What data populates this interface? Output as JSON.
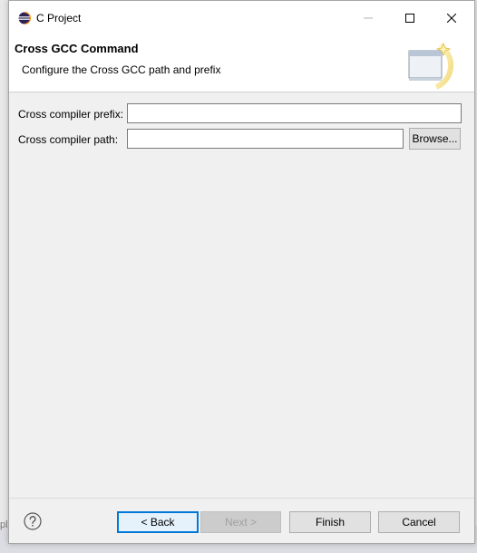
{
  "window": {
    "title": "C Project",
    "app_icon": "eclipse-icon",
    "controls": {
      "minimize_icon": "minimize-icon",
      "maximize_icon": "maximize-icon",
      "close_icon": "close-icon"
    }
  },
  "banner": {
    "title": "Cross GCC Command",
    "description": "Configure the Cross GCC path and prefix",
    "image_icon": "wizard-banner-icon"
  },
  "form": {
    "prefix_label": "Cross compiler prefix:",
    "prefix_value": "",
    "path_label": "Cross compiler path:",
    "path_value": "",
    "browse_label": "Browse..."
  },
  "footer": {
    "help_icon": "help-icon",
    "back_label": "< Back",
    "next_label": "Next >",
    "finish_label": "Finish",
    "cancel_label": "Cancel"
  },
  "background": {
    "partial_glyph": "pl"
  },
  "colors": {
    "accent": "#0078d7",
    "window_bg": "#f0f0f0",
    "banner_bg": "#ffffff"
  }
}
